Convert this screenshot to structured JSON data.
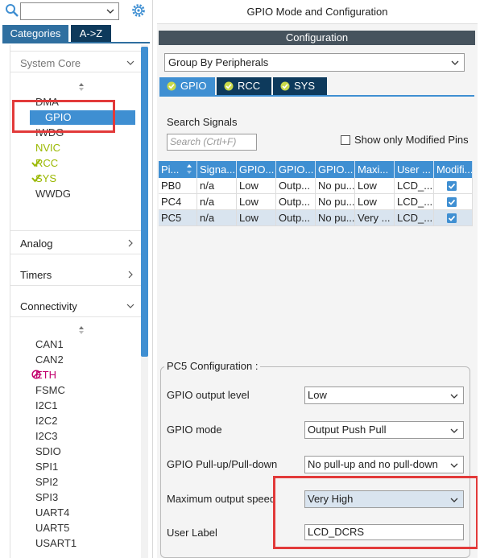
{
  "search": {
    "value": ""
  },
  "left_tabs": {
    "categories": "Categories",
    "az": "A->Z"
  },
  "sections": {
    "system_core": "System Core",
    "analog": "Analog",
    "timers": "Timers",
    "connectivity": "Connectivity"
  },
  "system_core_items": [
    "DMA",
    "GPIO",
    "IWDG",
    "NVIC",
    "RCC",
    "SYS",
    "WWDG"
  ],
  "connectivity_items": [
    "CAN1",
    "CAN2",
    "ETH",
    "FSMC",
    "I2C1",
    "I2C2",
    "I2C3",
    "SDIO",
    "SPI1",
    "SPI2",
    "SPI3",
    "UART4",
    "UART5",
    "USART1"
  ],
  "header": {
    "title": "GPIO Mode and Configuration",
    "configuration": "Configuration"
  },
  "group_by": "Group By Peripherals",
  "peripheral_tabs": [
    "GPIO",
    "RCC",
    "SYS"
  ],
  "signals": {
    "label": "Search Signals",
    "placeholder": "Search (Crtl+F)",
    "show_modified": "Show only Modified Pins"
  },
  "table": {
    "headers": [
      "Pi...",
      "Signa...",
      "GPIO...",
      "GPIO...",
      "GPIO...",
      "Maxi...",
      "User ...",
      "Modifi..."
    ],
    "rows": [
      [
        "PB0",
        "n/a",
        "Low",
        "Outp...",
        "No pu...",
        "Low",
        "LCD_..."
      ],
      [
        "PC4",
        "n/a",
        "Low",
        "Outp...",
        "No pu...",
        "Low",
        "LCD_..."
      ],
      [
        "PC5",
        "n/a",
        "Low",
        "Outp...",
        "No pu...",
        "Very ...",
        "LCD_..."
      ]
    ]
  },
  "pc5": {
    "title": "PC5 Configuration :",
    "fields": [
      {
        "label": "GPIO output level",
        "value": "Low"
      },
      {
        "label": "GPIO mode",
        "value": "Output Push Pull"
      },
      {
        "label": "GPIO Pull-up/Pull-down",
        "value": "No pull-up and no pull-down"
      },
      {
        "label": "Maximum output speed",
        "value": "Very High"
      }
    ],
    "user_label": {
      "label": "User Label",
      "value": "LCD_DCRS"
    }
  },
  "colors": {
    "accent": "#3f8fd2",
    "dark_tab": "#0e3a5c",
    "config_bar": "#46535d",
    "ok_green": "#9ab800",
    "error_magenta": "#c2006e",
    "highlight_red": "#e23a3a"
  }
}
